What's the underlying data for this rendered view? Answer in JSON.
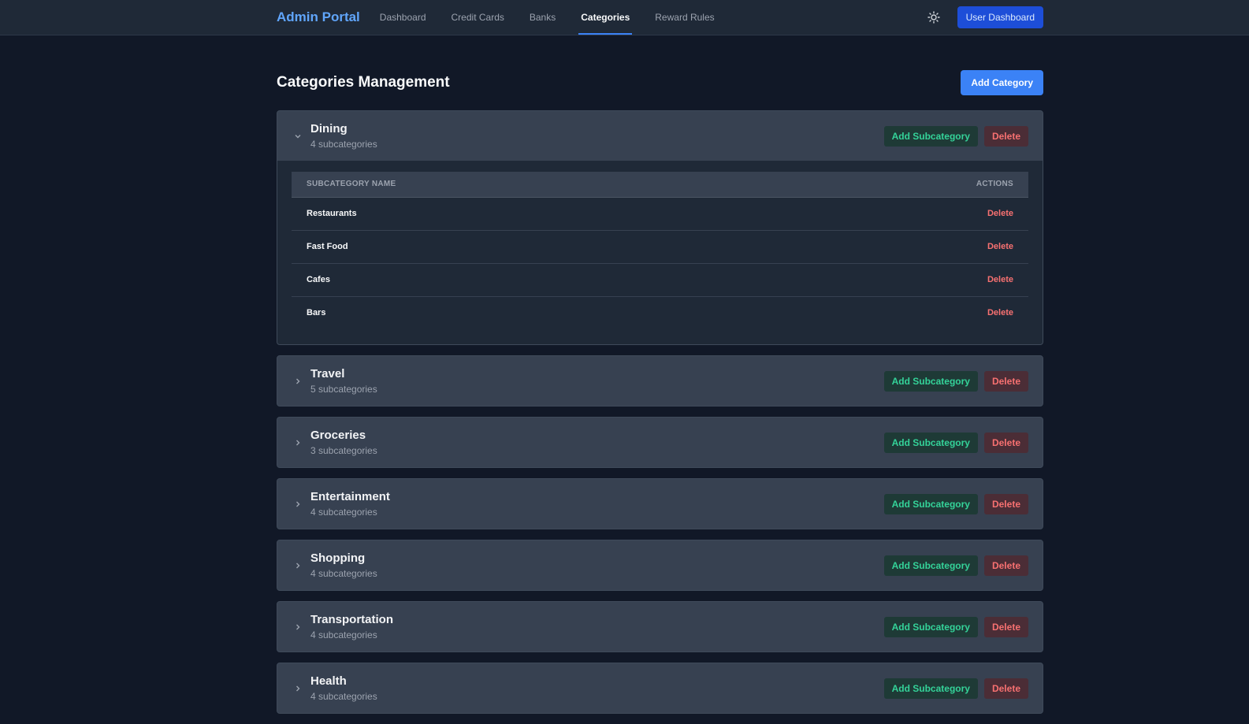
{
  "app": {
    "brand": "Admin Portal"
  },
  "nav": {
    "items": [
      {
        "label": "Dashboard",
        "active": false
      },
      {
        "label": "Credit Cards",
        "active": false
      },
      {
        "label": "Banks",
        "active": false
      },
      {
        "label": "Categories",
        "active": true
      },
      {
        "label": "Reward Rules",
        "active": false
      }
    ],
    "theme_icon": "sun-icon",
    "user_dashboard_label": "User Dashboard"
  },
  "page": {
    "title": "Categories Management",
    "add_category_label": "Add Category"
  },
  "table_headers": {
    "name": "SUBCATEGORY NAME",
    "actions": "ACTIONS"
  },
  "labels": {
    "add_subcategory": "Add Subcategory",
    "delete": "Delete"
  },
  "categories": [
    {
      "name": "Dining",
      "count_text": "4 subcategories",
      "expanded": true,
      "subcategories": [
        "Restaurants",
        "Fast Food",
        "Cafes",
        "Bars"
      ]
    },
    {
      "name": "Travel",
      "count_text": "5 subcategories",
      "expanded": false
    },
    {
      "name": "Groceries",
      "count_text": "3 subcategories",
      "expanded": false
    },
    {
      "name": "Entertainment",
      "count_text": "4 subcategories",
      "expanded": false
    },
    {
      "name": "Shopping",
      "count_text": "4 subcategories",
      "expanded": false
    },
    {
      "name": "Transportation",
      "count_text": "4 subcategories",
      "expanded": false
    },
    {
      "name": "Health",
      "count_text": "4 subcategories",
      "expanded": false
    }
  ],
  "colors": {
    "background": "#111827",
    "topbar": "#1f2937",
    "card": "#374151",
    "accent": "#3b82f6",
    "brand": "#60a5fa",
    "success": "#34d399",
    "danger": "#f87171"
  }
}
